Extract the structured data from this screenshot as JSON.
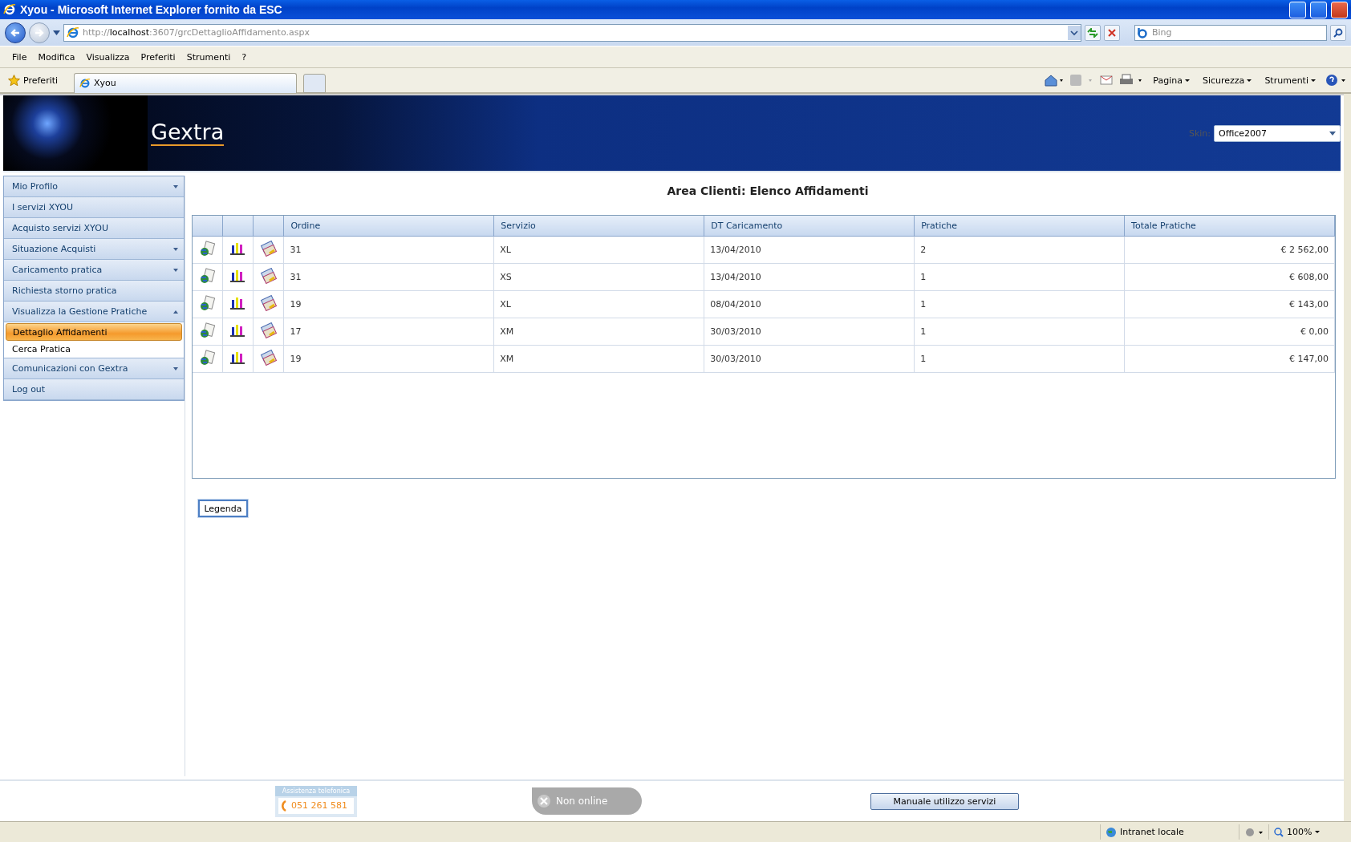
{
  "window": {
    "title": "Xyou - Microsoft Internet Explorer fornito da ESC"
  },
  "address_bar": {
    "url_scheme": "http://",
    "url_host": "localhost",
    "url_path": ":3607/grcDettaglioAffidamento.aspx"
  },
  "search": {
    "placeholder": "Bing"
  },
  "menu": [
    "File",
    "Modifica",
    "Visualizza",
    "Preferiti",
    "Strumenti",
    "?"
  ],
  "favorites": {
    "label": "Preferiti"
  },
  "tabs": [
    {
      "label": "Xyou",
      "selected": true
    }
  ],
  "command_bar": [
    "Pagina",
    "Sicurezza",
    "Strumenti"
  ],
  "header": {
    "logo": "Gextra",
    "skin_label": "Skin:",
    "skin_value": "Office2007"
  },
  "sidebar": {
    "items": [
      {
        "label": "Mio Profilo",
        "kind": "group",
        "expanded": false
      },
      {
        "label": "I servizi XYOU",
        "kind": "link"
      },
      {
        "label": "Acquisto servizi XYOU",
        "kind": "link"
      },
      {
        "label": "Situazione Acquisti",
        "kind": "group",
        "expanded": false
      },
      {
        "label": "Caricamento pratica",
        "kind": "group",
        "expanded": false
      },
      {
        "label": "Richiesta storno pratica",
        "kind": "link"
      },
      {
        "label": "Visualizza la Gestione Pratiche",
        "kind": "group",
        "expanded": true,
        "children": [
          {
            "label": "Dettaglio Affidamenti",
            "selected": true
          },
          {
            "label": "Cerca Pratica",
            "selected": false
          }
        ]
      },
      {
        "label": "Comunicazioni con Gextra",
        "kind": "group",
        "expanded": false
      },
      {
        "label": "Log out",
        "kind": "link"
      }
    ]
  },
  "page_title": "Area Clienti: Elenco Affidamenti",
  "table": {
    "columns": [
      "Ordine",
      "Servizio",
      "DT Caricamento",
      "Pratiche",
      "Totale Pratiche"
    ],
    "rows": [
      [
        "31",
        "XL",
        "13/04/2010",
        "2",
        "€ 2 562,00"
      ],
      [
        "31",
        "XS",
        "13/04/2010",
        "1",
        "€ 608,00"
      ],
      [
        "19",
        "XL",
        "08/04/2010",
        "1",
        "€ 143,00"
      ],
      [
        "17",
        "XM",
        "30/03/2010",
        "1",
        "€ 0,00"
      ],
      [
        "19",
        "XM",
        "30/03/2010",
        "1",
        "€ 147,00"
      ]
    ]
  },
  "legend_button": "Legenda",
  "footer": {
    "phone_title": "Assistenza telefonica",
    "phone_number": "051 261 581",
    "chat_status": "Non online",
    "manual_button": "Manuale utilizzo servizi"
  },
  "status_bar": {
    "zone": "Intranet locale",
    "zoom": "100%"
  }
}
